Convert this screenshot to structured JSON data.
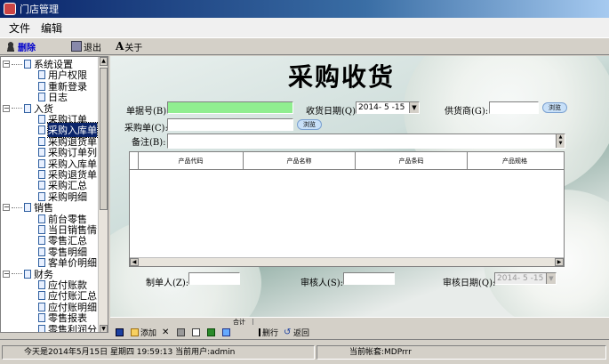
{
  "window": {
    "title": "门店管理"
  },
  "menu": {
    "file": "文件",
    "edit": "编辑"
  },
  "toolbar": {
    "item1": "删除",
    "logout": "退出",
    "about": "关于"
  },
  "tree": {
    "items": [
      {
        "label": "系统设置",
        "type": "group"
      },
      {
        "label": "用户权限",
        "type": "leaf"
      },
      {
        "label": "重新登录",
        "type": "leaf"
      },
      {
        "label": "日志",
        "type": "leaf"
      },
      {
        "label": "入货",
        "type": "group"
      },
      {
        "label": "采购订单",
        "type": "leaf"
      },
      {
        "label": "采购入库单",
        "type": "leaf",
        "selected": true
      },
      {
        "label": "采购退货单",
        "type": "leaf"
      },
      {
        "label": "采购订单列",
        "type": "leaf"
      },
      {
        "label": "采购入库单",
        "type": "leaf"
      },
      {
        "label": "采购退货单",
        "type": "leaf"
      },
      {
        "label": "采购汇总",
        "type": "leaf"
      },
      {
        "label": "采购明细",
        "type": "leaf"
      },
      {
        "label": "销售",
        "type": "group"
      },
      {
        "label": "前台零售",
        "type": "leaf"
      },
      {
        "label": "当日销售情",
        "type": "leaf"
      },
      {
        "label": "零售汇总",
        "type": "leaf"
      },
      {
        "label": "零售明细",
        "type": "leaf"
      },
      {
        "label": "客单价明细",
        "type": "leaf"
      },
      {
        "label": "财务",
        "type": "group"
      },
      {
        "label": "应付账款",
        "type": "leaf"
      },
      {
        "label": "应付账汇总",
        "type": "leaf"
      },
      {
        "label": "应付账明细",
        "type": "leaf"
      },
      {
        "label": "零售报表",
        "type": "leaf"
      },
      {
        "label": "零售利润分",
        "type": "leaf"
      }
    ]
  },
  "form": {
    "title": "采购收货",
    "doc_no_label": "单据号(B):",
    "doc_no_value": "",
    "recv_date_label": "收货日期(Q):",
    "recv_date_value": "2014- 5 -15",
    "supplier_label": "供货商(G):",
    "supplier_value": "",
    "browse": "浏览",
    "po_label": "采购单(C):",
    "po_value": "",
    "remark_label": "备注(B):",
    "remark_value": "",
    "maker_label": "制单人(Z):",
    "maker_value": "",
    "auditor_label": "审核人(S):",
    "auditor_value": "",
    "audit_date_label": "审核日期(Q):",
    "audit_date_value": "2014- 5 -15"
  },
  "grid": {
    "columns": [
      "产品代码",
      "产品名称",
      "产品条码",
      "产品规格"
    ]
  },
  "footer": {
    "total_label": "合计"
  },
  "bottom_toolbar": {
    "add": "添加",
    "delete_row": "删行",
    "back": "返回"
  },
  "status": {
    "datetime": "今天是2014年5月15日 星期四 19:59:13 当前用户:admin",
    "account": "当前帐套:MDPrrr"
  }
}
